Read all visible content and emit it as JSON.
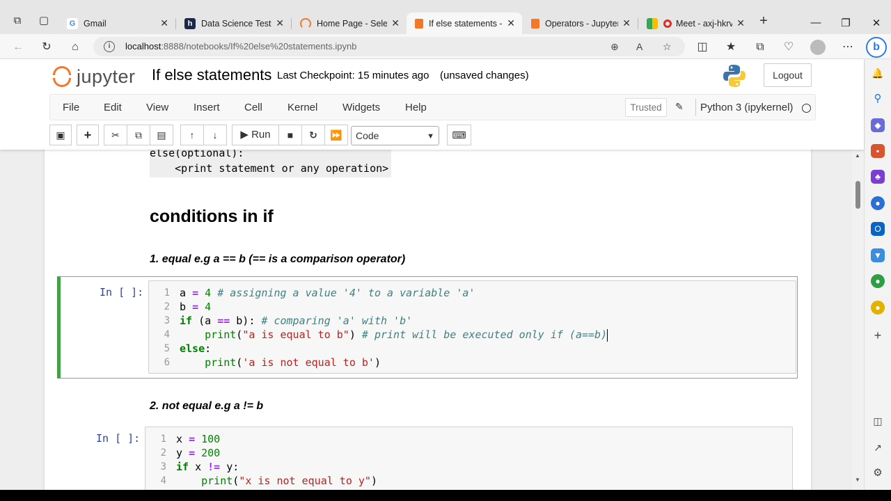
{
  "browser": {
    "tabs": [
      {
        "title": "Gmail",
        "icon": "google-icon",
        "active": false
      },
      {
        "title": "Data Science Test Nu",
        "icon": "hackerrank-icon",
        "active": false
      },
      {
        "title": "Home Page - Select o",
        "icon": "loading-spinner-icon",
        "active": false
      },
      {
        "title": "If else statements - Ju",
        "icon": "jupyter-book-icon",
        "active": true
      },
      {
        "title": "Operators - Jupyter N",
        "icon": "jupyter-book-icon",
        "active": false
      },
      {
        "title": "Meet - axj-hkrv-",
        "icon": "google-meet-icon",
        "active": false
      }
    ],
    "new_tab": "+",
    "url": {
      "host": "localhost",
      "path": ":8888/notebooks/If%20else%20statements.ipynb"
    }
  },
  "jupyter": {
    "logo_text": "jupyter",
    "notebook_title": "If else statements",
    "checkpoint": "Last Checkpoint: 15 minutes ago",
    "status": "(unsaved changes)",
    "logout_label": "Logout",
    "menu": [
      "File",
      "Edit",
      "View",
      "Insert",
      "Cell",
      "Kernel",
      "Widgets",
      "Help"
    ],
    "trusted_label": "Trusted",
    "kernel_name": "Python 3 (ipykernel)",
    "toolbar": {
      "run_label": "Run",
      "cell_type": "Code"
    }
  },
  "notebook": {
    "md_code_lines": [
      "else(optional):",
      "    <print statement or any operation>"
    ],
    "heading": "conditions in if",
    "sub1": "1. equal e.g a == b (== is a comparison operator)",
    "sub2": "2. not equal e.g a != b",
    "cell1": {
      "prompt": "In [ ]:",
      "line_numbers": [
        "1",
        "2",
        "3",
        "4",
        "5",
        "6"
      ]
    },
    "cell2": {
      "prompt": "In [ ]:",
      "line_numbers": [
        "1",
        "2",
        "3",
        "4"
      ]
    }
  },
  "colors": {
    "jupyter_orange": "#f37726",
    "selected_cell": "#42a047",
    "prompt_blue": "#303f9f",
    "keyword_green": "#008000"
  }
}
